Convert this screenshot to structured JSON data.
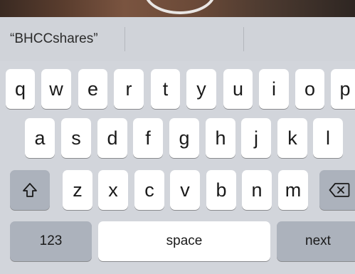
{
  "suggestions": {
    "items": [
      "“BHCCshares”",
      "",
      ""
    ]
  },
  "keyboard": {
    "row1": [
      "q",
      "w",
      "e",
      "r",
      "t",
      "y",
      "u",
      "i",
      "o",
      "p"
    ],
    "row2": [
      "a",
      "s",
      "d",
      "f",
      "g",
      "h",
      "j",
      "k",
      "l"
    ],
    "row3": [
      "z",
      "x",
      "c",
      "v",
      "b",
      "n",
      "m"
    ],
    "shift_icon": "shift-arrow-icon",
    "delete_icon": "backspace-icon",
    "numbers_label": "123",
    "space_label": "space",
    "return_label": "next"
  },
  "colors": {
    "keyboard_bg": "#d2d5db",
    "letter_key": "#ffffff",
    "function_key": "#acb2bc"
  }
}
